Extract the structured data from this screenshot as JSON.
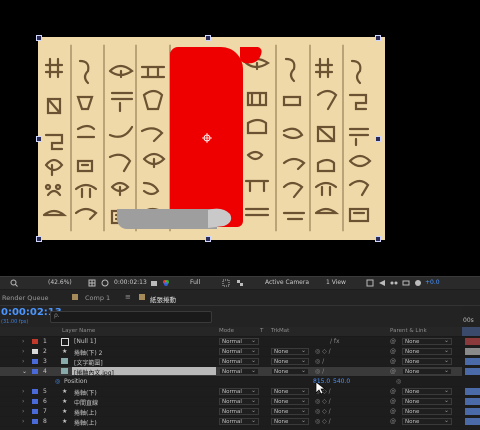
{
  "viewer": {
    "toolbar": {
      "zoom": "(42.6%)",
      "time": "0:00:02:13",
      "resolution": "Full",
      "camera": "Active Camera",
      "views": "1 View",
      "exposure": "+0.0"
    }
  },
  "panels": {
    "render_queue": "Render Queue",
    "comp1": "Comp 1",
    "active_comp": "紙張捲動"
  },
  "timeline": {
    "timecode": "0:00:02:13",
    "timecode_sub": "(31.00 fps)",
    "search_placeholder": "",
    "ruler_label": "00s",
    "columns": {
      "layer_name": "Layer Name",
      "mode": "Mode",
      "t": "T",
      "trkmat": "TrkMat",
      "parent": "Parent & Link"
    },
    "layers": [
      {
        "num": "1",
        "name": "[Null 1]",
        "mode": "Normal",
        "trkmat": "",
        "parent": "None",
        "color": "#c0392b",
        "icon": "null-icon"
      },
      {
        "num": "2",
        "name": "捲軸(下) 2",
        "mode": "Normal",
        "trkmat": "None",
        "parent": "None",
        "color": "#d9d9d9",
        "icon": "star-icon"
      },
      {
        "num": "3",
        "name": "[文字範圍]",
        "mode": "Normal",
        "trkmat": "None",
        "parent": "None",
        "color": "#4a6ad8",
        "icon": "footage-icon"
      },
      {
        "num": "4",
        "name": "[捲軸內文.jpg]",
        "mode": "Normal",
        "trkmat": "None",
        "parent": "None",
        "color": "#4a6ad8",
        "icon": "footage-icon"
      },
      {
        "num": "5",
        "name": "捲軸(下)",
        "mode": "Normal",
        "trkmat": "None",
        "parent": "None",
        "color": "#4a6ad8",
        "icon": "star-icon"
      },
      {
        "num": "6",
        "name": "中間直線",
        "mode": "Normal",
        "trkmat": "None",
        "parent": "None",
        "color": "#4a6ad8",
        "icon": "star-icon"
      },
      {
        "num": "7",
        "name": "捲軸(上)",
        "mode": "Normal",
        "trkmat": "None",
        "parent": "None",
        "color": "#4a6ad8",
        "icon": "star-icon"
      },
      {
        "num": "8",
        "name": "捲軸(上)",
        "mode": "Normal",
        "trkmat": "None",
        "parent": "None",
        "color": "#4a6ad8",
        "icon": "star-icon"
      }
    ],
    "position_property": {
      "label": "Position",
      "value_x": "815.0",
      "value_y": "540.0"
    }
  },
  "colors": {
    "accent": "#4b96ff",
    "scroll_red": "#ee0000",
    "paper": "#f0d9a8",
    "glyph": "#6b5232"
  }
}
